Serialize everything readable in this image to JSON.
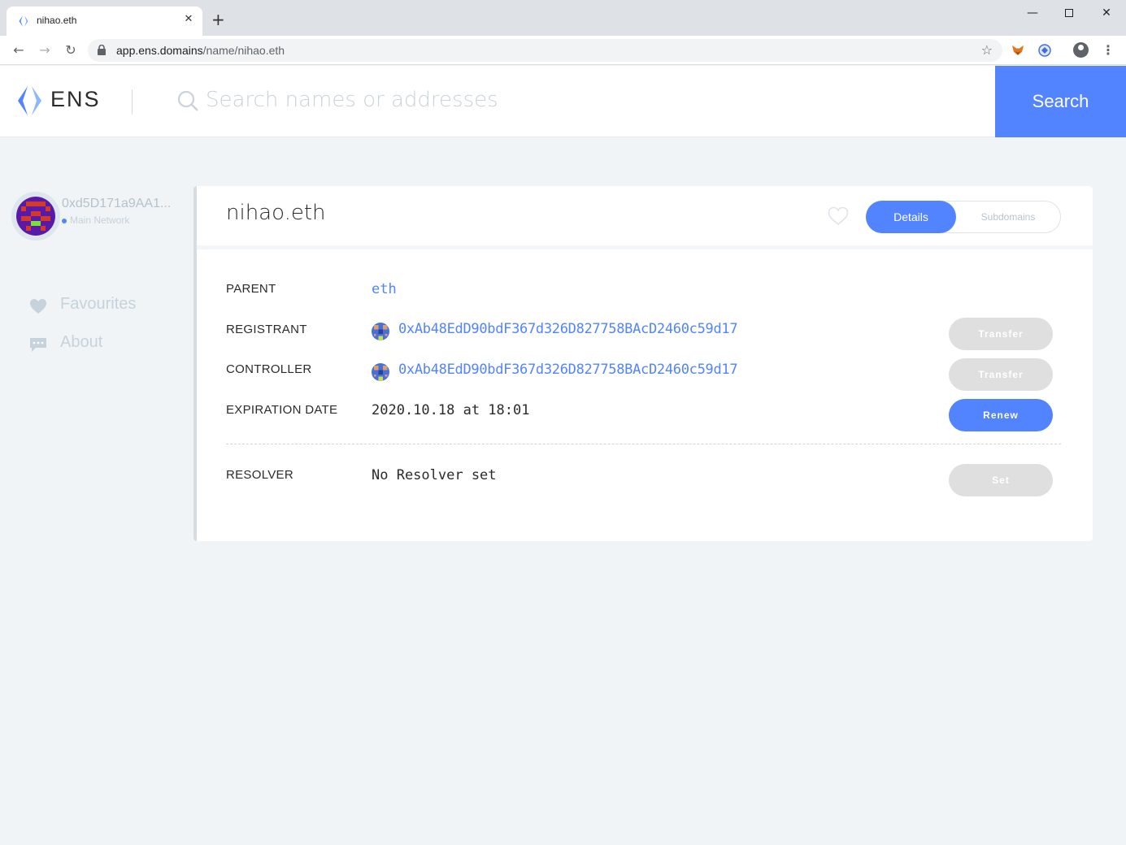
{
  "browser": {
    "tab_title": "nihao.eth",
    "tab_close": "✕",
    "new_tab": "+",
    "url_host": "app.ens.domains",
    "url_path": "/name/nihao.eth",
    "window_min": "—",
    "window_close": "✕"
  },
  "header": {
    "wordmark": "ENS",
    "search_placeholder": "Search names or addresses",
    "search_button": "Search",
    "accent_color": "#5284ff"
  },
  "sidebar": {
    "account_address": "0xd5D171a9AA1...",
    "network": "Main Network",
    "links": [
      {
        "label": "Favourites",
        "icon": "heart-icon"
      },
      {
        "label": "About",
        "icon": "chat-icon"
      }
    ]
  },
  "domain": {
    "name": "nihao.eth",
    "tabs": {
      "details": "Details",
      "subdomains": "Subdomains"
    },
    "rows": {
      "parent": {
        "label": "PARENT",
        "value": "eth"
      },
      "registrant": {
        "label": "REGISTRANT",
        "value": "0xAb48EdD90bdF367d326D827758BAcD2460c59d17",
        "action": "Transfer"
      },
      "controller": {
        "label": "CONTROLLER",
        "value": "0xAb48EdD90bdF367d326D827758BAcD2460c59d17",
        "action": "Transfer"
      },
      "expiration": {
        "label": "EXPIRATION DATE",
        "value": "2020.10.18 at 18:01",
        "action": "Renew"
      },
      "resolver": {
        "label": "RESOLVER",
        "value": "No Resolver set",
        "action": "Set"
      }
    }
  }
}
